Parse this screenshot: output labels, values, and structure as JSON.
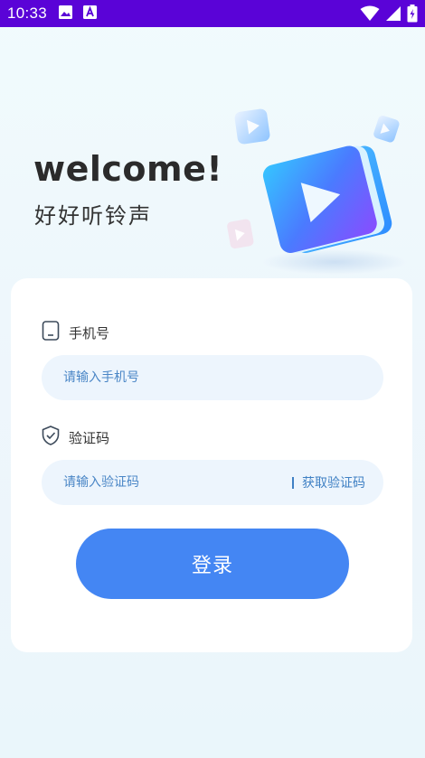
{
  "status_bar": {
    "time": "10:33",
    "left_icons": [
      "image-icon",
      "text-icon"
    ],
    "right_icons": [
      "wifi-icon",
      "signal-icon",
      "battery-icon"
    ],
    "bg_color": "#5a03d7"
  },
  "hero": {
    "welcome": "welcome!",
    "tagline": "好好听铃声",
    "graphic": "play-button-illustration"
  },
  "login_form": {
    "phone": {
      "label": "手机号",
      "icon": "phone-icon",
      "placeholder": "请输入手机号",
      "value": ""
    },
    "code": {
      "label": "验证码",
      "icon": "shield-check-icon",
      "placeholder": "请输入验证码",
      "value": "",
      "get_code_label": "获取验证码"
    },
    "submit_label": "登录"
  },
  "colors": {
    "accent": "#4486f3",
    "input_bg": "#edf5fd",
    "placeholder_text": "#4a86c6"
  }
}
